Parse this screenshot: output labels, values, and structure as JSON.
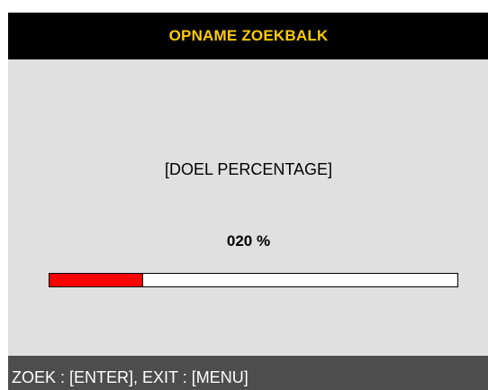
{
  "header": {
    "title": "OPNAME ZOEKBALK"
  },
  "main": {
    "target_label": "[DOEL PERCENTAGE]",
    "percent_text": "020 %",
    "progress_fraction": 0.23
  },
  "footer": {
    "hint": "ZOEK : [ENTER], EXIT : [MENU]"
  },
  "colors": {
    "title_text": "#ffcc00",
    "progress_fill": "#ff0000"
  }
}
